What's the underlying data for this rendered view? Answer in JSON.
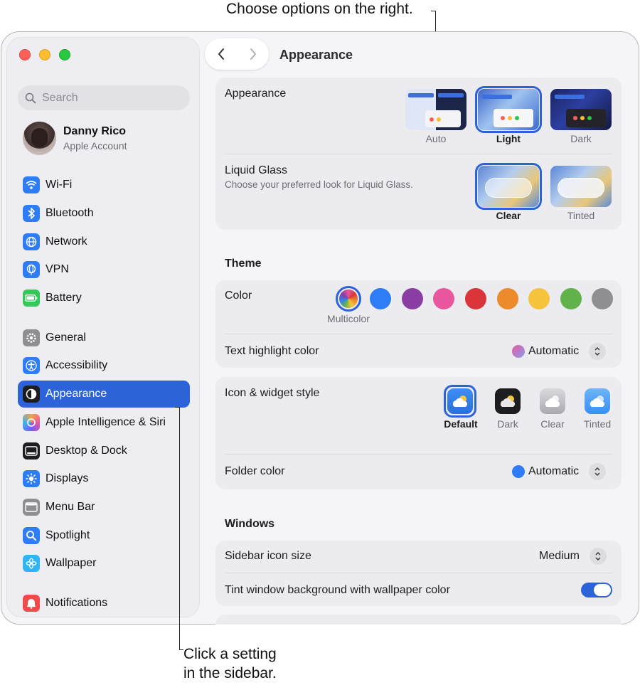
{
  "callouts": {
    "top": "Choose options on the right.",
    "bottom_line1": "Click a setting",
    "bottom_line2": "in the sidebar."
  },
  "sidebar": {
    "search_placeholder": "Search",
    "account": {
      "name": "Danny Rico",
      "subtitle": "Apple Account"
    },
    "items": [
      {
        "label": "Wi-Fi",
        "icon": "wifi-icon",
        "color": "#2f7df6"
      },
      {
        "label": "Bluetooth",
        "icon": "bluetooth-icon",
        "color": "#2f7df6"
      },
      {
        "label": "Network",
        "icon": "globe-icon",
        "color": "#2f7df6"
      },
      {
        "label": "VPN",
        "icon": "vpn-globe-icon",
        "color": "#2f7df6"
      },
      {
        "label": "Battery",
        "icon": "battery-icon",
        "color": "#34c759"
      },
      {
        "label": "General",
        "icon": "gear-icon",
        "color": "#8e8e93"
      },
      {
        "label": "Accessibility",
        "icon": "accessibility-icon",
        "color": "#2f7df6"
      },
      {
        "label": "Appearance",
        "icon": "appearance-icon",
        "color": "#1d1d1f",
        "active": true
      },
      {
        "label": "Apple Intelligence & Siri",
        "icon": "siri-icon",
        "color": "#e67cc4"
      },
      {
        "label": "Desktop & Dock",
        "icon": "dock-icon",
        "color": "#1d1d1f"
      },
      {
        "label": "Displays",
        "icon": "sun-icon",
        "color": "#2f7df6"
      },
      {
        "label": "Menu Bar",
        "icon": "menubar-icon",
        "color": "#8e8e93"
      },
      {
        "label": "Spotlight",
        "icon": "magnifier-icon",
        "color": "#2f7df6"
      },
      {
        "label": "Wallpaper",
        "icon": "flower-icon",
        "color": "#2fb5f6"
      },
      {
        "label": "Notifications",
        "icon": "bell-icon",
        "color": "#f04a4a"
      }
    ]
  },
  "header": {
    "title": "Appearance"
  },
  "appearance_card": {
    "label": "Appearance",
    "options": [
      "Auto",
      "Light",
      "Dark"
    ],
    "selected": "Light",
    "glass_label": "Liquid Glass",
    "glass_sub": "Choose your preferred look for Liquid Glass.",
    "glass_options": [
      "Clear",
      "Tinted"
    ],
    "glass_selected": "Clear"
  },
  "theme": {
    "heading": "Theme",
    "color_label": "Color",
    "multicolor_caption": "Multicolor",
    "colors": [
      "multicolor",
      "#2f7df6",
      "#8a3ea4",
      "#e8579e",
      "#d9353a",
      "#ec8a2c",
      "#f5c43c",
      "#62b24c",
      "#8e8e93"
    ],
    "highlight_label": "Text highlight color",
    "highlight_value": "Automatic"
  },
  "icon_style": {
    "label": "Icon & widget style",
    "options": [
      "Default",
      "Dark",
      "Clear",
      "Tinted"
    ],
    "selected": "Default",
    "folder_label": "Folder color",
    "folder_value": "Automatic"
  },
  "windows": {
    "heading": "Windows",
    "sidebar_icon_label": "Sidebar icon size",
    "sidebar_icon_value": "Medium",
    "tint_label": "Tint window background with wallpaper color",
    "tint_on": true
  }
}
